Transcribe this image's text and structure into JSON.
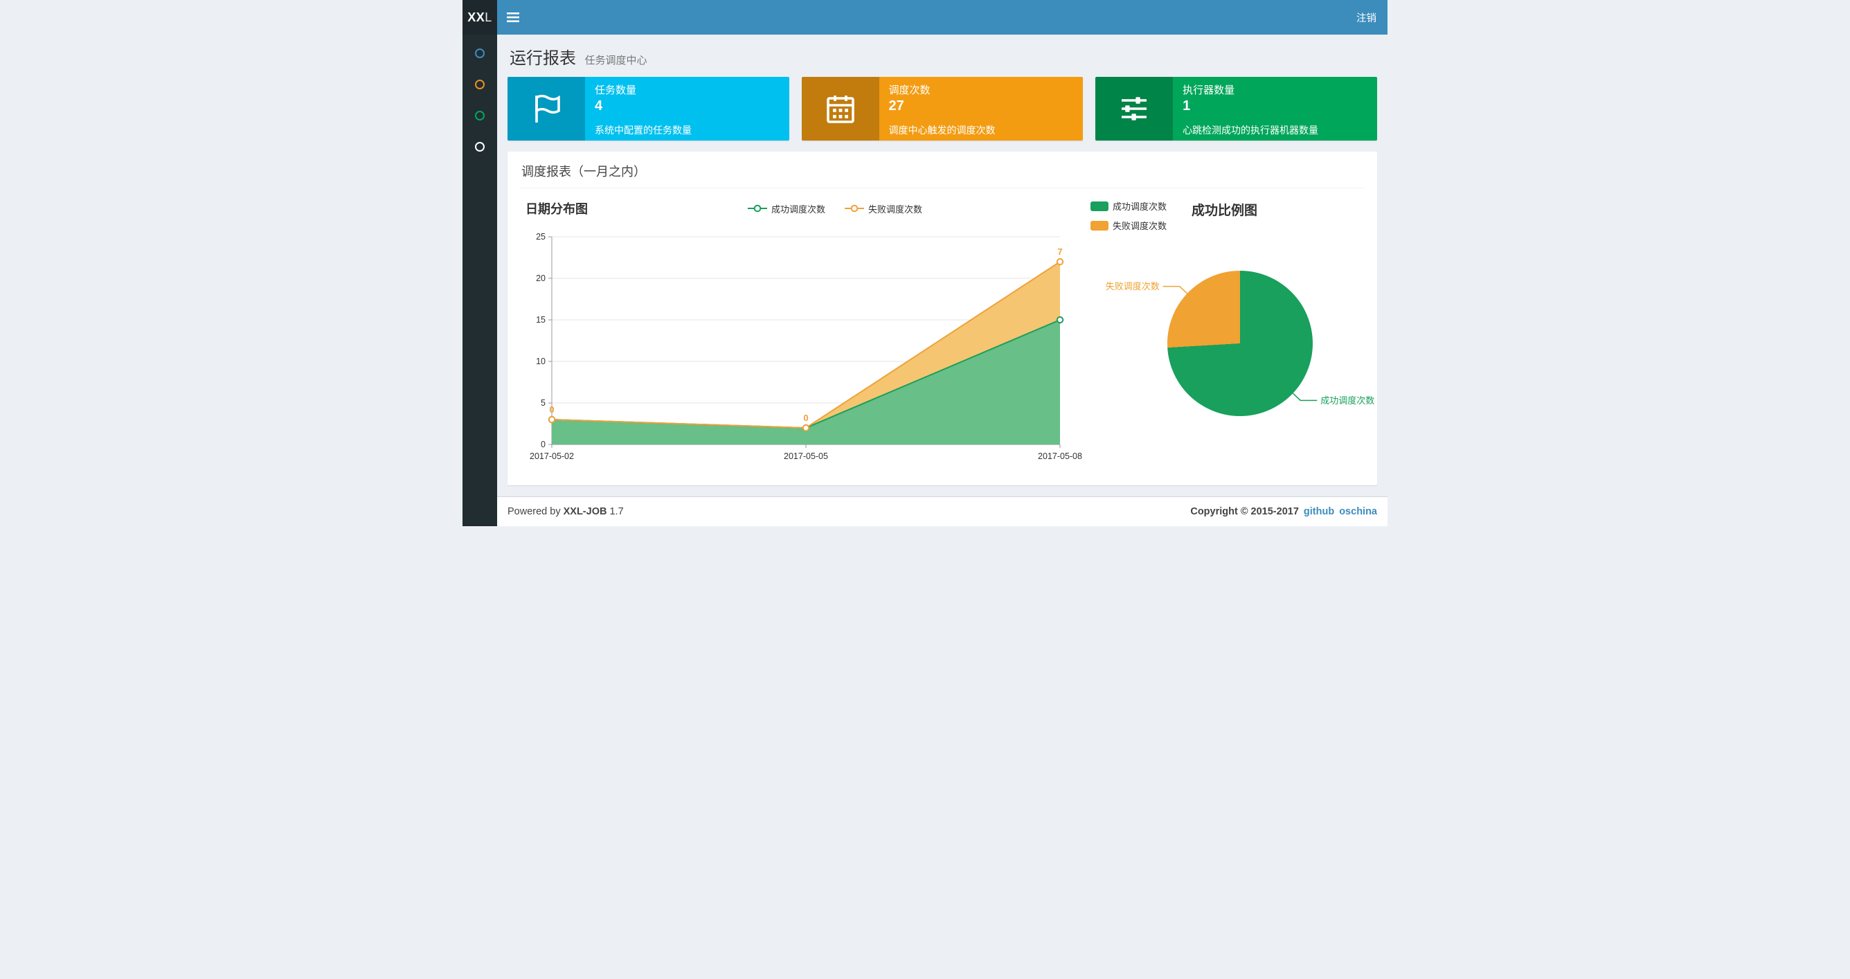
{
  "header": {
    "logo_bold": "XX",
    "logo_light": "L",
    "logout_label": "注销"
  },
  "sidebar": {
    "items": [
      {
        "name": "menu-item-1",
        "color": "#3c8dbc"
      },
      {
        "name": "menu-item-2",
        "color": "#e8931c"
      },
      {
        "name": "menu-item-3",
        "color": "#00a65a"
      },
      {
        "name": "menu-item-4",
        "color": "#ffffff"
      }
    ]
  },
  "page": {
    "title": "运行报表",
    "subtitle": "任务调度中心"
  },
  "info_boxes": [
    {
      "icon": "flag-icon",
      "title": "任务数量",
      "value": "4",
      "desc": "系统中配置的任务数量",
      "color": "#00c0ef"
    },
    {
      "icon": "calendar-icon",
      "title": "调度次数",
      "value": "27",
      "desc": "调度中心触发的调度次数",
      "color": "#f39c12"
    },
    {
      "icon": "sliders-icon",
      "title": "执行器数量",
      "value": "1",
      "desc": "心跳检测成功的执行器机器数量",
      "color": "#00a65a"
    }
  ],
  "panel": {
    "title": "调度报表（一月之内）"
  },
  "chart_data": [
    {
      "type": "area",
      "title": "日期分布图",
      "categories": [
        "2017-05-02",
        "2017-05-05",
        "2017-05-08"
      ],
      "stacked": true,
      "series": [
        {
          "name": "成功调度次数",
          "values": [
            3,
            2,
            15
          ],
          "color": "#1b9e5a",
          "fill": "#68bf88"
        },
        {
          "name": "失败调度次数",
          "values": [
            0,
            0,
            7
          ],
          "color": "#efa23a",
          "fill": "#f5c572",
          "labels": [
            "0",
            "0",
            "7"
          ]
        }
      ],
      "ylim": [
        0,
        25
      ],
      "yticks": [
        0,
        5,
        10,
        15,
        20,
        25
      ],
      "xlabel": "",
      "ylabel": "",
      "legend_position": "top-center",
      "grid": true
    },
    {
      "type": "pie",
      "title": "成功比例图",
      "start_angle": "top-clockwise",
      "legend_position": "top-left",
      "slices": [
        {
          "name": "成功调度次数",
          "value": 20,
          "color": "#18a05c"
        },
        {
          "name": "失败调度次数",
          "value": 7,
          "color": "#f0a232"
        }
      ]
    }
  ],
  "footer": {
    "powered_prefix": "Powered by",
    "product": "XXL-JOB",
    "version": "1.7",
    "copyright": "Copyright © 2015-2017",
    "links": [
      {
        "label": "github"
      },
      {
        "label": "oschina"
      }
    ]
  }
}
